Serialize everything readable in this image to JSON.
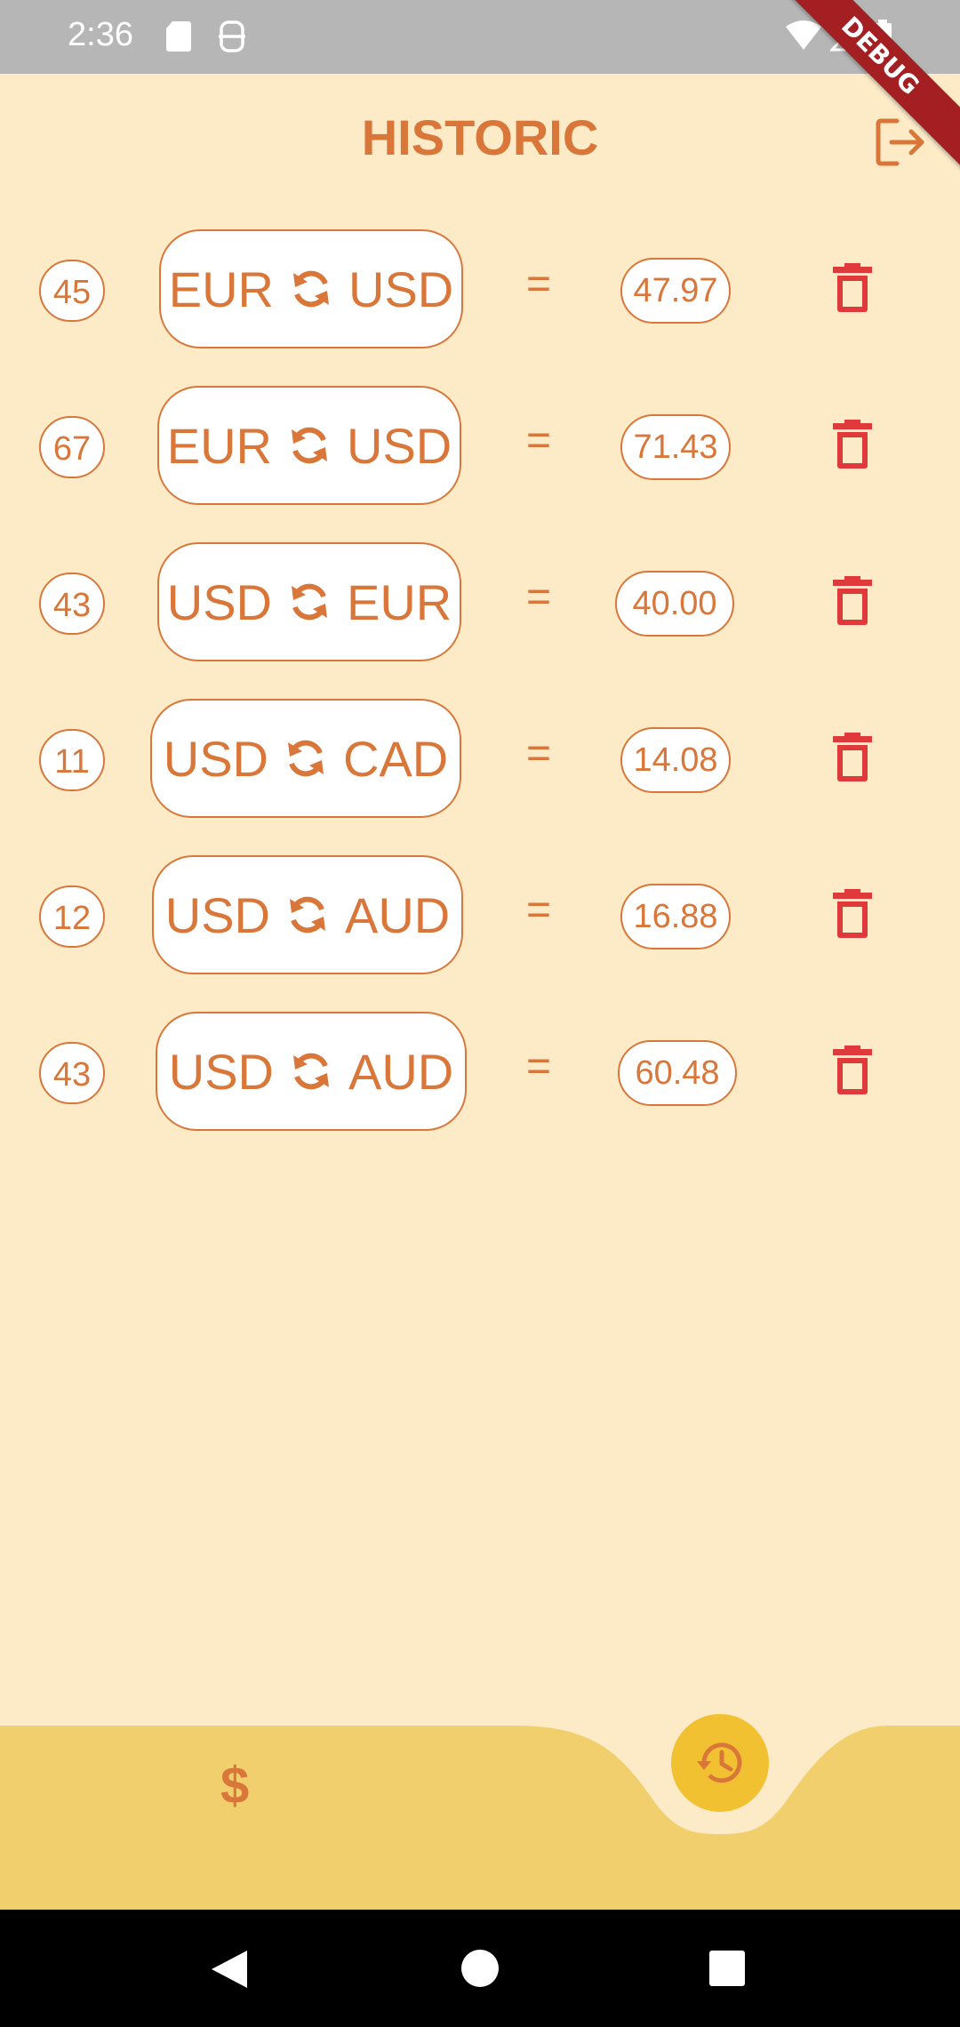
{
  "status_bar": {
    "time": "2:36"
  },
  "debug_banner": "DEBUG",
  "header": {
    "title": "HISTORIC"
  },
  "history": [
    {
      "amount": "45",
      "from": "EUR",
      "to": "USD",
      "result": "47.97"
    },
    {
      "amount": "67",
      "from": "EUR",
      "to": "USD",
      "result": "71.43"
    },
    {
      "amount": "43",
      "from": "USD",
      "to": "EUR",
      "result": "40.00"
    },
    {
      "amount": "11",
      "from": "USD",
      "to": "CAD",
      "result": "14.08"
    },
    {
      "amount": "12",
      "from": "USD",
      "to": "AUD",
      "result": "16.88"
    },
    {
      "amount": "43",
      "from": "USD",
      "to": "AUD",
      "result": "60.48"
    }
  ],
  "equals_sign": "=",
  "bottom_nav": {
    "convert_label": "$",
    "history_icon": "history-icon",
    "active": "history"
  },
  "colors": {
    "background": "#FDEBC8",
    "accent": "#D9773A",
    "delete": "#E0393B",
    "nav_bar": "#F1CF6D",
    "fab": "#F2C132"
  }
}
